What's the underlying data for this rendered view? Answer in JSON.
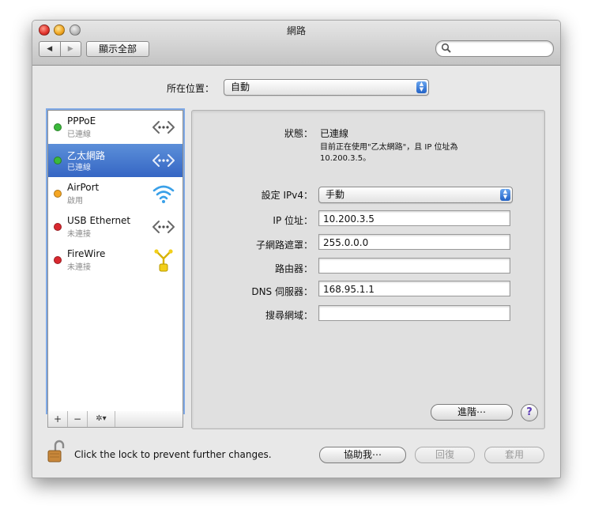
{
  "window": {
    "title": "網路"
  },
  "toolbar": {
    "back_label": "◀",
    "forward_label": "▶",
    "show_all_label": "顯示全部",
    "search_placeholder": ""
  },
  "location": {
    "label": "所在位置：",
    "value": "自動"
  },
  "services": [
    {
      "name": "PPPoE",
      "status": "已連線",
      "status_color": "#3bb93b",
      "icon": "ethernet-arrows-icon",
      "selected": false
    },
    {
      "name": "乙太網路",
      "status": "已連線",
      "status_color": "#3bb93b",
      "icon": "ethernet-arrows-icon",
      "selected": true
    },
    {
      "name": "AirPort",
      "status": "啟用",
      "status_color": "#f5a623",
      "icon": "wifi-icon",
      "selected": false
    },
    {
      "name": "USB Ethernet",
      "status": "未連接",
      "status_color": "#d9282f",
      "icon": "ethernet-arrows-icon",
      "selected": false
    },
    {
      "name": "FireWire",
      "status": "未連接",
      "status_color": "#d9282f",
      "icon": "firewire-icon",
      "selected": false
    }
  ],
  "sidebar_tools": {
    "add": "+",
    "remove": "−",
    "gear": "✲▾"
  },
  "detail": {
    "status_label": "狀態：",
    "status_value": "已連線",
    "status_desc_line1": "目前正在使用\"乙太網路\"，且 IP 位址為",
    "status_desc_line2": "10.200.3.5。",
    "configure_label": "設定 IPv4：",
    "configure_value": "手動",
    "ip_label": "IP 位址：",
    "ip_value": "10.200.3.5",
    "subnet_label": "子網路遮罩：",
    "subnet_value": "255.0.0.0",
    "router_label": "路由器：",
    "router_value": "",
    "dns_label": "DNS 伺服器：",
    "dns_value": "168.95.1.1",
    "search_domains_label": "搜尋網域：",
    "search_domains_value": "",
    "advanced_label": "進階⋯",
    "help_label": "?"
  },
  "footer": {
    "lock_text": "Click the lock to prevent further changes.",
    "assist_label": "協助我⋯",
    "revert_label": "回復",
    "apply_label": "套用"
  }
}
